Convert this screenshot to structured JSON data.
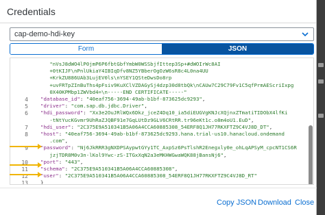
{
  "dialog": {
    "title": "Credentials"
  },
  "select": {
    "value": "cap-demo-hdi-key"
  },
  "tabs": [
    {
      "label": "Form"
    },
    {
      "label": "JSON"
    }
  ],
  "editor": {
    "lines": [
      {
        "num": "",
        "parts": [
          [
            "s",
            "   \"nVsJ8dWO4lP0jmP6P6fbtGbfYmbW0WSSbjfIttep3Sp+#dWOIrWc8AI"
          ]
        ]
      },
      {
        "num": "",
        "parts": [
          [
            "s",
            "   +0tKIJF\\nPnlUkiaY4IBIqDfv8NZ5YBberOgOzW6sR8c4L0na4UU"
          ]
        ]
      },
      {
        "num": "",
        "parts": [
          [
            "s",
            "   +KrkZU886UAb3LujEV0ls\\nYSEY1QSteDwsDo8rp"
          ]
        ]
      },
      {
        "num": "",
        "parts": [
          [
            "s",
            "   +uvFRTpZInBuThs4pFsiv9KuXClVZDAGySj4dzp30d8tbQk\\nCAUw7C29C79Fv1C5qfPrmAEScriIxpg"
          ]
        ]
      },
      {
        "num": "",
        "parts": [
          [
            "s",
            "   0X40KPMbp1ZWVbd4=\\n-----END CERTIFICATE-----\""
          ]
        ]
      },
      {
        "num": "4",
        "parts": [
          [
            "k",
            "\"database_id\""
          ],
          [
            "p",
            ": "
          ],
          [
            "s",
            "\"40eaf756-3694-49ab-b1bf-873625dc9293\""
          ],
          [
            "p",
            ","
          ]
        ]
      },
      {
        "num": "5",
        "parts": [
          [
            "k",
            "\"driver\""
          ],
          [
            "p",
            ": "
          ],
          [
            "s",
            "\"com.sap.db.jdbc.Driver\""
          ],
          [
            "p",
            ","
          ]
        ]
      },
      {
        "num": "6",
        "parts": [
          [
            "k",
            "\"hdi_password\""
          ],
          [
            "p",
            ": "
          ],
          [
            "s",
            "\"Xx3e2OuJRlWQx6Dkz_jceZ4Dq10_ia5diEUGVgKNJcXQjnxZTmatiTIDObX4lfKi"
          ]
        ]
      },
      {
        "num": "",
        "parts": [
          [
            "s",
            "   -tNtYucKGvmr9UhRaZJQBF91e7GqLUtDz9GLV6CRtRR.tr96eKt1c.o8m4oU1.EuD\""
          ],
          [
            "p",
            ","
          ]
        ]
      },
      {
        "num": "7",
        "parts": [
          [
            "k",
            "\"hdi_user\""
          ],
          [
            "p",
            ": "
          ],
          [
            "s",
            "\"2C375E9A510341B5A06A4CCA60885308_54ERF8Q1JH77RKXFTZ9C4VJ8D_DT\""
          ],
          [
            "p",
            ","
          ]
        ]
      },
      {
        "num": "8",
        "parts": [
          [
            "k",
            "\"host\""
          ],
          [
            "p",
            ": "
          ],
          [
            "s",
            "\"40eaf756-3694-49ab-b1bf-873625dc9293.hana.trial-us10.hanacloud.ondemand"
          ]
        ]
      },
      {
        "num": "",
        "parts": [
          [
            "s",
            "   .com\""
          ],
          [
            "p",
            ","
          ]
        ]
      },
      {
        "num": "9",
        "parts": [
          [
            "k",
            "\"password\""
          ],
          [
            "p",
            ": "
          ],
          [
            "s",
            "\"Nj6JkRRR3gNXDPSAypwtGYy1TC_AxpSz6PsTlshR2Enegxly0e_ohLqAPSyM_cpcNT1CS6R"
          ]
        ]
      },
      {
        "num": "",
        "parts": [
          [
            "s",
            "   jzjTDR8M0v3n-lKol9Ywc-zS-ITGxXqN2a3eMKHWGwaWQK88jBansNj6\""
          ],
          [
            "p",
            ","
          ]
        ]
      },
      {
        "num": "10",
        "parts": [
          [
            "k",
            "\"port\""
          ],
          [
            "p",
            ": "
          ],
          [
            "s",
            "\"443\""
          ],
          [
            "p",
            ","
          ]
        ]
      },
      {
        "num": "11",
        "parts": [
          [
            "k",
            "\"schema\""
          ],
          [
            "p",
            ": "
          ],
          [
            "s",
            "\"2C375E9A510341B5A06A4CCA60885308\""
          ],
          [
            "p",
            ","
          ]
        ]
      },
      {
        "num": "12",
        "parts": [
          [
            "k",
            "\"user\""
          ],
          [
            "p",
            ": "
          ],
          [
            "s",
            "\"2C375E9A510341B5A06A4CCA60885308_54ERF8Q1JH77RKXFTZ9C4VJ8D_RT\""
          ]
        ]
      },
      {
        "num": "13",
        "parts": [
          [
            "p",
            "}"
          ]
        ]
      }
    ]
  },
  "footer": {
    "copy_json": "Copy JSON",
    "download": "Download",
    "close": "Close"
  },
  "colors": {
    "accent": "#0a6ed1",
    "active_tab": "#0854a0",
    "arrow": "#f0b400",
    "json_key": "#8a2d8a",
    "json_string": "#2a7a2a"
  }
}
